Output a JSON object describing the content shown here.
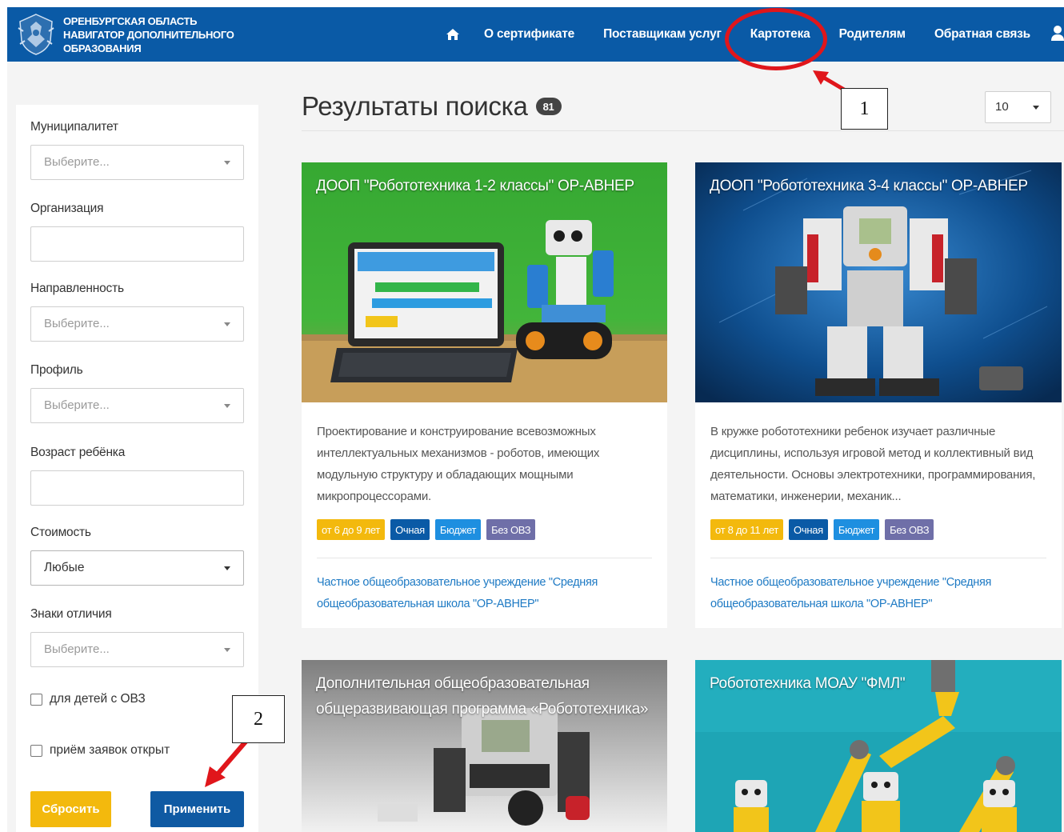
{
  "header": {
    "brand_line1": "ОРЕНБУРГСКАЯ ОБЛАСТЬ",
    "brand_line2": "НАВИГАТОР ДОПОЛНИТЕЛЬНОГО",
    "brand_line3": "ОБРАЗОВАНИЯ",
    "nav": [
      {
        "label": "О сертификате"
      },
      {
        "label": "Поставщикам услуг"
      },
      {
        "label": "Картотека"
      },
      {
        "label": "Родителям"
      },
      {
        "label": "Обратная связь"
      }
    ],
    "colors": {
      "navbar": "#0a5aa6"
    }
  },
  "filters": {
    "municipality": {
      "label": "Муниципалитет",
      "placeholder": "Выберите..."
    },
    "organization": {
      "label": "Организация",
      "value": ""
    },
    "direction": {
      "label": "Направленность",
      "placeholder": "Выберите..."
    },
    "profile": {
      "label": "Профиль",
      "placeholder": "Выберите..."
    },
    "child_age": {
      "label": "Возраст ребёнка",
      "value": ""
    },
    "cost": {
      "label": "Стоимость",
      "value": "Любые"
    },
    "distinctions": {
      "label": "Знаки отличия",
      "placeholder": "Выберите..."
    },
    "ovz_checkbox": {
      "label": "для детей с ОВЗ",
      "checked": false
    },
    "open_checkbox": {
      "label": "приём заявок открыт",
      "checked": false
    },
    "reset_label": "Сбросить",
    "apply_label": "Применить"
  },
  "results": {
    "title": "Результаты поиска",
    "count": "81",
    "per_page": "10"
  },
  "cards": [
    {
      "title": "ДООП \"Робототехника 1-2 классы\" ОР-АВНЕР",
      "description": "Проектирование и конструирование всевозможных интеллектуальных механизмов - роботов, имеющих модульную структуру и обладающих мощными микропроцессорами.",
      "tags": {
        "age": "от 6 до 9 лет",
        "form": "Очная",
        "budget": "Бюджет",
        "ovz": "Без ОВЗ"
      },
      "organization": "Частное общеобразовательное учреждение \"Средняя общеобразовательная школа \"ОР-АВНЕР\""
    },
    {
      "title": "ДООП \"Робототехника 3-4 классы\" ОР-АВНЕР",
      "description": "В кружке робототехники ребенок изучает различные дисциплины, используя игровой метод и коллективный вид деятельности. Основы электротехники, программирования, математики, инженерии, механик...",
      "tags": {
        "age": "от 8 до 11 лет",
        "form": "Очная",
        "budget": "Бюджет",
        "ovz": "Без ОВЗ"
      },
      "organization": "Частное общеобразовательное учреждение \"Средняя общеобразовательная школа \"ОР-АВНЕР\""
    },
    {
      "title": "Дополнительная общеобразовательная общеразвивающая программа «Робототехника»"
    },
    {
      "title": "Робототехника МОАУ \"ФМЛ\""
    }
  ],
  "annotations": {
    "marker1": "1",
    "marker2": "2",
    "color": "#e0161b"
  }
}
